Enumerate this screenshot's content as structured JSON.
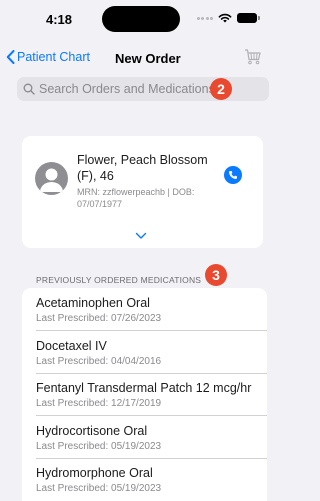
{
  "status_bar": {
    "time": "4:18",
    "icons": [
      "signal-dots-icon",
      "wifi-icon",
      "battery-icon"
    ]
  },
  "nav": {
    "back_label": "Patient Chart",
    "title": "Order",
    "prefix_bold": "New Order",
    "cart_icon": "cart-icon"
  },
  "search": {
    "placeholder": "Search Orders and Medications",
    "value": ""
  },
  "annotations": {
    "badge_2": "2",
    "badge_3": "3"
  },
  "patient": {
    "name": "Flower, Peach Blossom (F), 46",
    "mrn_line": "MRN: zzflowerpeachb | DOB: 07/07/1977"
  },
  "section": {
    "header": "PREVIOUSLY ORDERED MEDICATIONS"
  },
  "medications": [
    {
      "name": "Acetaminophen Oral",
      "last_prescribed": "Last Prescribed:  07/26/2023"
    },
    {
      "name": "Docetaxel IV",
      "last_prescribed": "Last Prescribed:  04/04/2016"
    },
    {
      "name": "Fentanyl Transdermal Patch 12 mcg/hr",
      "last_prescribed": "Last Prescribed:  12/17/2019"
    },
    {
      "name": "Hydrocortisone Oral",
      "last_prescribed": "Last Prescribed:  05/19/2023"
    },
    {
      "name": "Hydromorphone Oral",
      "last_prescribed": "Last Prescribed:  05/19/2023"
    }
  ],
  "colors": {
    "accent": "#0a7aff",
    "badge": "#e8492f",
    "background": "#f2f2f6"
  }
}
